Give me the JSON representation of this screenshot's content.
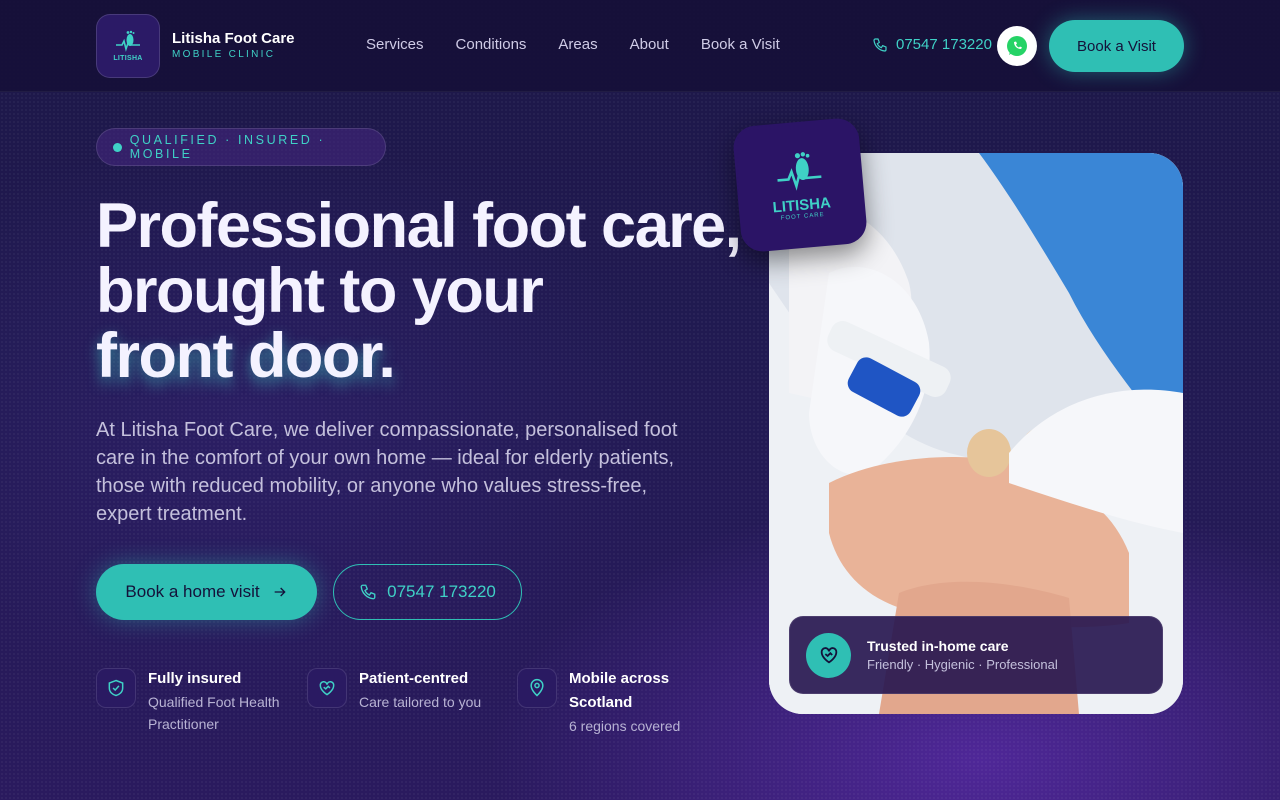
{
  "brand": {
    "name": "Litisha Foot Care",
    "tagline": "MOBILE CLINIC",
    "logo_text": "LITISHA",
    "logo_subtext": "FOOT CARE"
  },
  "nav": {
    "items": [
      "Services",
      "Conditions",
      "Areas",
      "About",
      "Book a Visit"
    ]
  },
  "header": {
    "phone": "07547 173220",
    "book_label": "Book a Visit",
    "whatsapp_icon": "whatsapp-icon"
  },
  "hero": {
    "badge": "QUALIFIED · INSURED · MOBILE",
    "headline_lines": [
      "Professional foot care,",
      "brought to your",
      "front door."
    ],
    "lead": "At Litisha Foot Care, we deliver compassionate, personalised foot care in the comfort of your own home — ideal for elderly patients, those with reduced mobility, or anyone who values stress-free, expert treatment.",
    "cta_primary": "Book a home visit",
    "cta_secondary": "07547 173220"
  },
  "features": [
    {
      "title": "Fully insured",
      "subtitle": "Qualified Foot Health Practitioner",
      "icon": "shield-check-icon"
    },
    {
      "title": "Patient-centred",
      "subtitle": "Care tailored to you",
      "icon": "heart-hand-icon"
    },
    {
      "title": "Mobile across Scotland",
      "subtitle": "6 regions covered",
      "icon": "map-pin-icon"
    }
  ],
  "trust_card": {
    "title": "Trusted in-home care",
    "subtitle": "Friendly · Hygienic · Professional",
    "icon": "heart-hand-icon"
  },
  "colors": {
    "accent": "#2fbfb4",
    "accent_text": "#3fd1c6",
    "background": "#1d1748",
    "logo_bg": "#2b1466"
  }
}
